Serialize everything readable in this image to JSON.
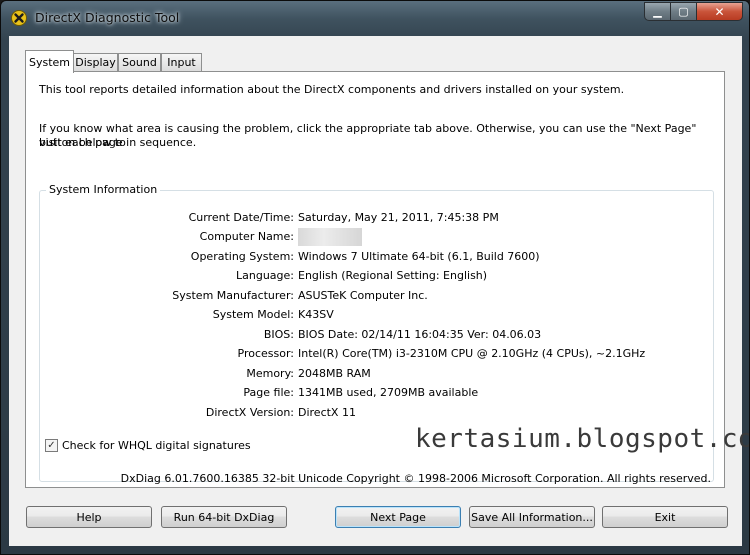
{
  "window": {
    "title": "DirectX Diagnostic Tool",
    "close_glyph": "✕",
    "min_glyph": "▁",
    "max_glyph": "▢"
  },
  "tabs": [
    {
      "label": "System",
      "selected": true
    },
    {
      "label": "Display",
      "selected": false
    },
    {
      "label": "Sound",
      "selected": false
    },
    {
      "label": "Input",
      "selected": false
    }
  ],
  "intro": {
    "line1": "This tool reports detailed information about the DirectX components and drivers installed on your system.",
    "line2": "If you know what area is causing the problem, click the appropriate tab above.  Otherwise, you can use the \"Next Page\" button below to",
    "line3": "visit each page in sequence."
  },
  "system_info": {
    "title": "System Information",
    "rows": [
      {
        "label": "Current Date/Time:",
        "value": "Saturday, May 21, 2011, 7:45:38 PM"
      },
      {
        "label": "Computer Name:",
        "value": ""
      },
      {
        "label": "Operating System:",
        "value": "Windows 7 Ultimate 64-bit (6.1, Build 7600)"
      },
      {
        "label": "Language:",
        "value": "English (Regional Setting: English)"
      },
      {
        "label": "System Manufacturer:",
        "value": "ASUSTeK Computer Inc."
      },
      {
        "label": "System Model:",
        "value": "K43SV"
      },
      {
        "label": "BIOS:",
        "value": "BIOS Date: 02/14/11 16:04:35 Ver: 04.06.03"
      },
      {
        "label": "Processor:",
        "value": "Intel(R) Core(TM) i3-2310M CPU @ 2.10GHz (4 CPUs), ~2.1GHz"
      },
      {
        "label": "Memory:",
        "value": "2048MB RAM"
      },
      {
        "label": "Page file:",
        "value": "1341MB used, 2709MB available"
      },
      {
        "label": "DirectX Version:",
        "value": "DirectX 11"
      }
    ]
  },
  "whql": {
    "label": "Check for WHQL digital signatures",
    "checked": true,
    "check_glyph": "✓"
  },
  "watermark": "kertasium.blogspot.com",
  "copyright": "DxDiag 6.01.7600.16385 32-bit Unicode  Copyright © 1998-2006 Microsoft Corporation.  All rights reserved.",
  "buttons": {
    "help": "Help",
    "run64": "Run 64-bit DxDiag",
    "next": "Next Page",
    "save": "Save All Information...",
    "exit": "Exit"
  }
}
